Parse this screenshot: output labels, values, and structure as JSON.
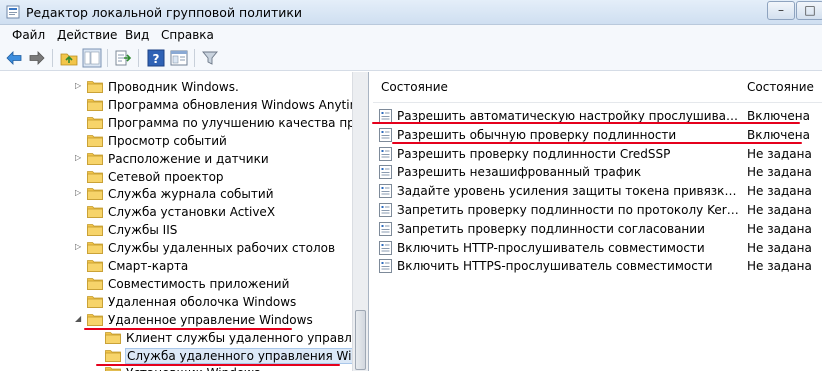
{
  "window": {
    "title": "Редактор локальной групповой политики",
    "buttons": [
      "–",
      "□"
    ]
  },
  "menubar": [
    "Файл",
    "Действие",
    "Вид",
    "Справка"
  ],
  "toolbar": {
    "icons": [
      "back-arrow-icon",
      "forward-arrow-icon",
      "folder-up-icon",
      "show-hide-tree-icon",
      "export-list-icon",
      "help-icon",
      "properties-icon",
      "filter-icon"
    ]
  },
  "tree": {
    "items": [
      {
        "label": "Проводник Windows.",
        "arrow": "▷"
      },
      {
        "label": "Программа обновления Windows Anytime U",
        "arrow": ""
      },
      {
        "label": "Программа по улучшению качества програ",
        "arrow": ""
      },
      {
        "label": "Просмотр событий",
        "arrow": ""
      },
      {
        "label": "Расположение и датчики",
        "arrow": "▷"
      },
      {
        "label": "Сетевой проектор",
        "arrow": ""
      },
      {
        "label": "Служба журнала событий",
        "arrow": "▷"
      },
      {
        "label": "Служба установки ActiveX",
        "arrow": ""
      },
      {
        "label": "Службы IIS",
        "arrow": ""
      },
      {
        "label": "Службы удаленных рабочих столов",
        "arrow": "▷"
      },
      {
        "label": "Смарт-карта",
        "arrow": ""
      },
      {
        "label": "Совместимость приложений",
        "arrow": ""
      },
      {
        "label": "Удаленная оболочка Windows",
        "arrow": ""
      },
      {
        "label": "Удаленное управление Windows",
        "arrow": "◢"
      },
      {
        "label": "Клиент службы удаленного управления",
        "arrow": ""
      },
      {
        "label": "Служба удаленного управления Window",
        "arrow": ""
      },
      {
        "label": "Установщик Windows",
        "arrow": ""
      }
    ]
  },
  "list": {
    "headers": {
      "name": "Состояние",
      "state": "Состояние"
    },
    "rows": [
      {
        "name": "Разрешить автоматическую настройку прослушивателей",
        "state": "Включена"
      },
      {
        "name": "Разрешить обычную проверку подлинности",
        "state": "Включена"
      },
      {
        "name": "Разрешить проверку подлинности CredSSP",
        "state": "Не задана"
      },
      {
        "name": "Разрешить незашифрованный трафик",
        "state": "Не задана"
      },
      {
        "name": "Задайте уровень усиления защиты токена привязки кана...",
        "state": "Не задана"
      },
      {
        "name": "Запретить проверку подлинности по протоколу Kerberos.",
        "state": "Не задана"
      },
      {
        "name": "Запретить проверку подлинности согласовании",
        "state": "Не задана"
      },
      {
        "name": "Включить HTTP-прослушиватель совместимости",
        "state": "Не задана"
      },
      {
        "name": "Включить HTTPS-прослушиватель совместимости",
        "state": "Не задана"
      }
    ]
  },
  "colors": {
    "accent": "#2d6bbd",
    "annotation": "#e5001c",
    "folder": "#f2c54a"
  }
}
